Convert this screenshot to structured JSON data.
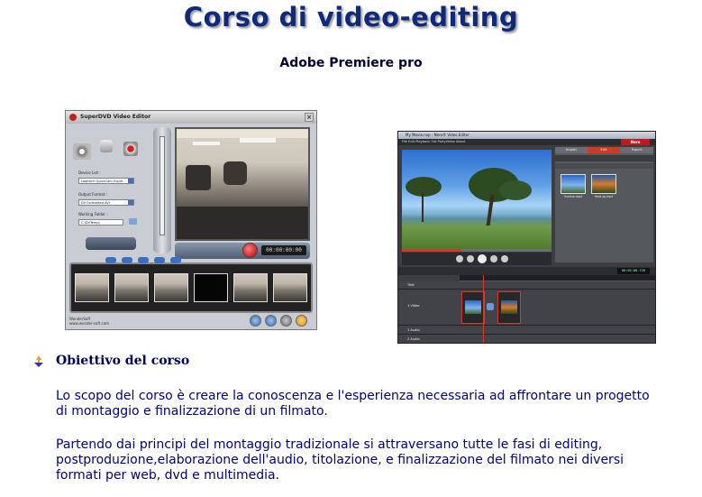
{
  "header": {
    "title": "Corso di video-editing",
    "subtitle": "Adobe Premiere pro"
  },
  "screenshot_left": {
    "window_title": "SuperDVD Video Editor",
    "labels": {
      "device_list": "Device List :",
      "device_value": "Logitech QuickCam Expre",
      "output_format": "Output Format :",
      "output_value": "DV Formatted AVI",
      "working_folder": "Working Folder :",
      "folder_value": "C:\\DVTemp\\"
    },
    "timecode": "00:00:00:00",
    "footer_line1": "WonderSoft",
    "footer_line2": "www.wonder-soft.com"
  },
  "screenshot_right": {
    "window_title": "My Movie.nvp - Nero® Video Editor",
    "menu": "File   Edit   Playback   3rd PartyVideo   About",
    "brand": "Nero",
    "tabs": [
      "Import",
      "Edit",
      "Export"
    ],
    "thumb_labels": [
      "Sunrise.mp4",
      "Hold up.mp4"
    ],
    "timecode": "00:02:08.726",
    "track_labels": [
      "Title",
      "1 Video",
      "1 Audio",
      "2 Audio"
    ]
  },
  "section": {
    "heading": "Obiettivo del corso",
    "para1": [
      "Lo scopo del corso è creare la conoscenza e l'esperienza necessaria ad affrontare un progetto",
      "di montaggio e finalizzazione di un filmato."
    ],
    "para2": [
      "Partendo dai principi del montaggio tradizionale si attraversano tutte le fasi di editing,",
      "postproduzione,elaborazione dell'audio, titolazione, e finalizzazione del filmato nei diversi",
      "formati per web, dvd e multimedia."
    ]
  },
  "colors": {
    "title": "#0f2a7a",
    "body_text": "#000080",
    "accent_red": "#c2181e"
  }
}
